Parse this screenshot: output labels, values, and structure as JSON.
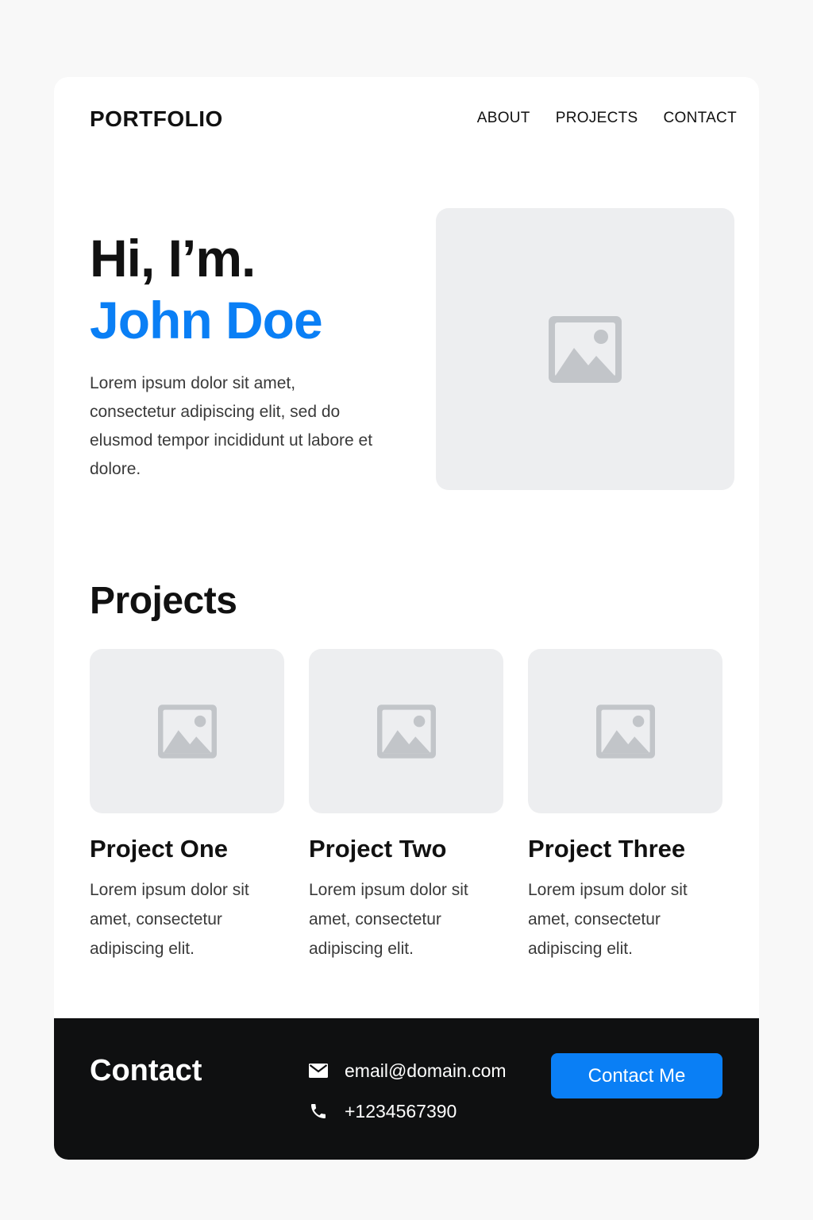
{
  "header": {
    "logo": "PORTFOLIO",
    "nav": [
      {
        "label": "ABOUT"
      },
      {
        "label": "PROJECTS"
      },
      {
        "label": "CONTACT"
      }
    ]
  },
  "hero": {
    "greeting": "Hi, I’m.",
    "name": "John Doe",
    "description": "Lorem ipsum dolor sit amet, consectetur adipiscing elit, sed do elusmod tempor incididunt ut labore et dolore.",
    "image_icon": "image-placeholder-icon"
  },
  "projects": {
    "title": "Projects",
    "items": [
      {
        "title": "Project One",
        "description": "Lorem ipsum dolor sit amet, consectetur adipiscing elit."
      },
      {
        "title": "Project Two",
        "description": "Lorem ipsum dolor sit amet, consectetur adipiscing elit."
      },
      {
        "title": "Project Three",
        "description": "Lorem ipsum dolor sit amet, consectetur adipiscing elit."
      }
    ]
  },
  "contact": {
    "title": "Contact",
    "email": "email@domain.com",
    "phone": "+1234567390",
    "email_icon": "mail-icon",
    "phone_icon": "phone-icon",
    "button_label": "Contact Me"
  },
  "colors": {
    "accent": "#0a7ff5",
    "footer_bg": "#0f1011",
    "placeholder_bg": "#edeef0",
    "placeholder_icon": "#c2c5c9"
  }
}
